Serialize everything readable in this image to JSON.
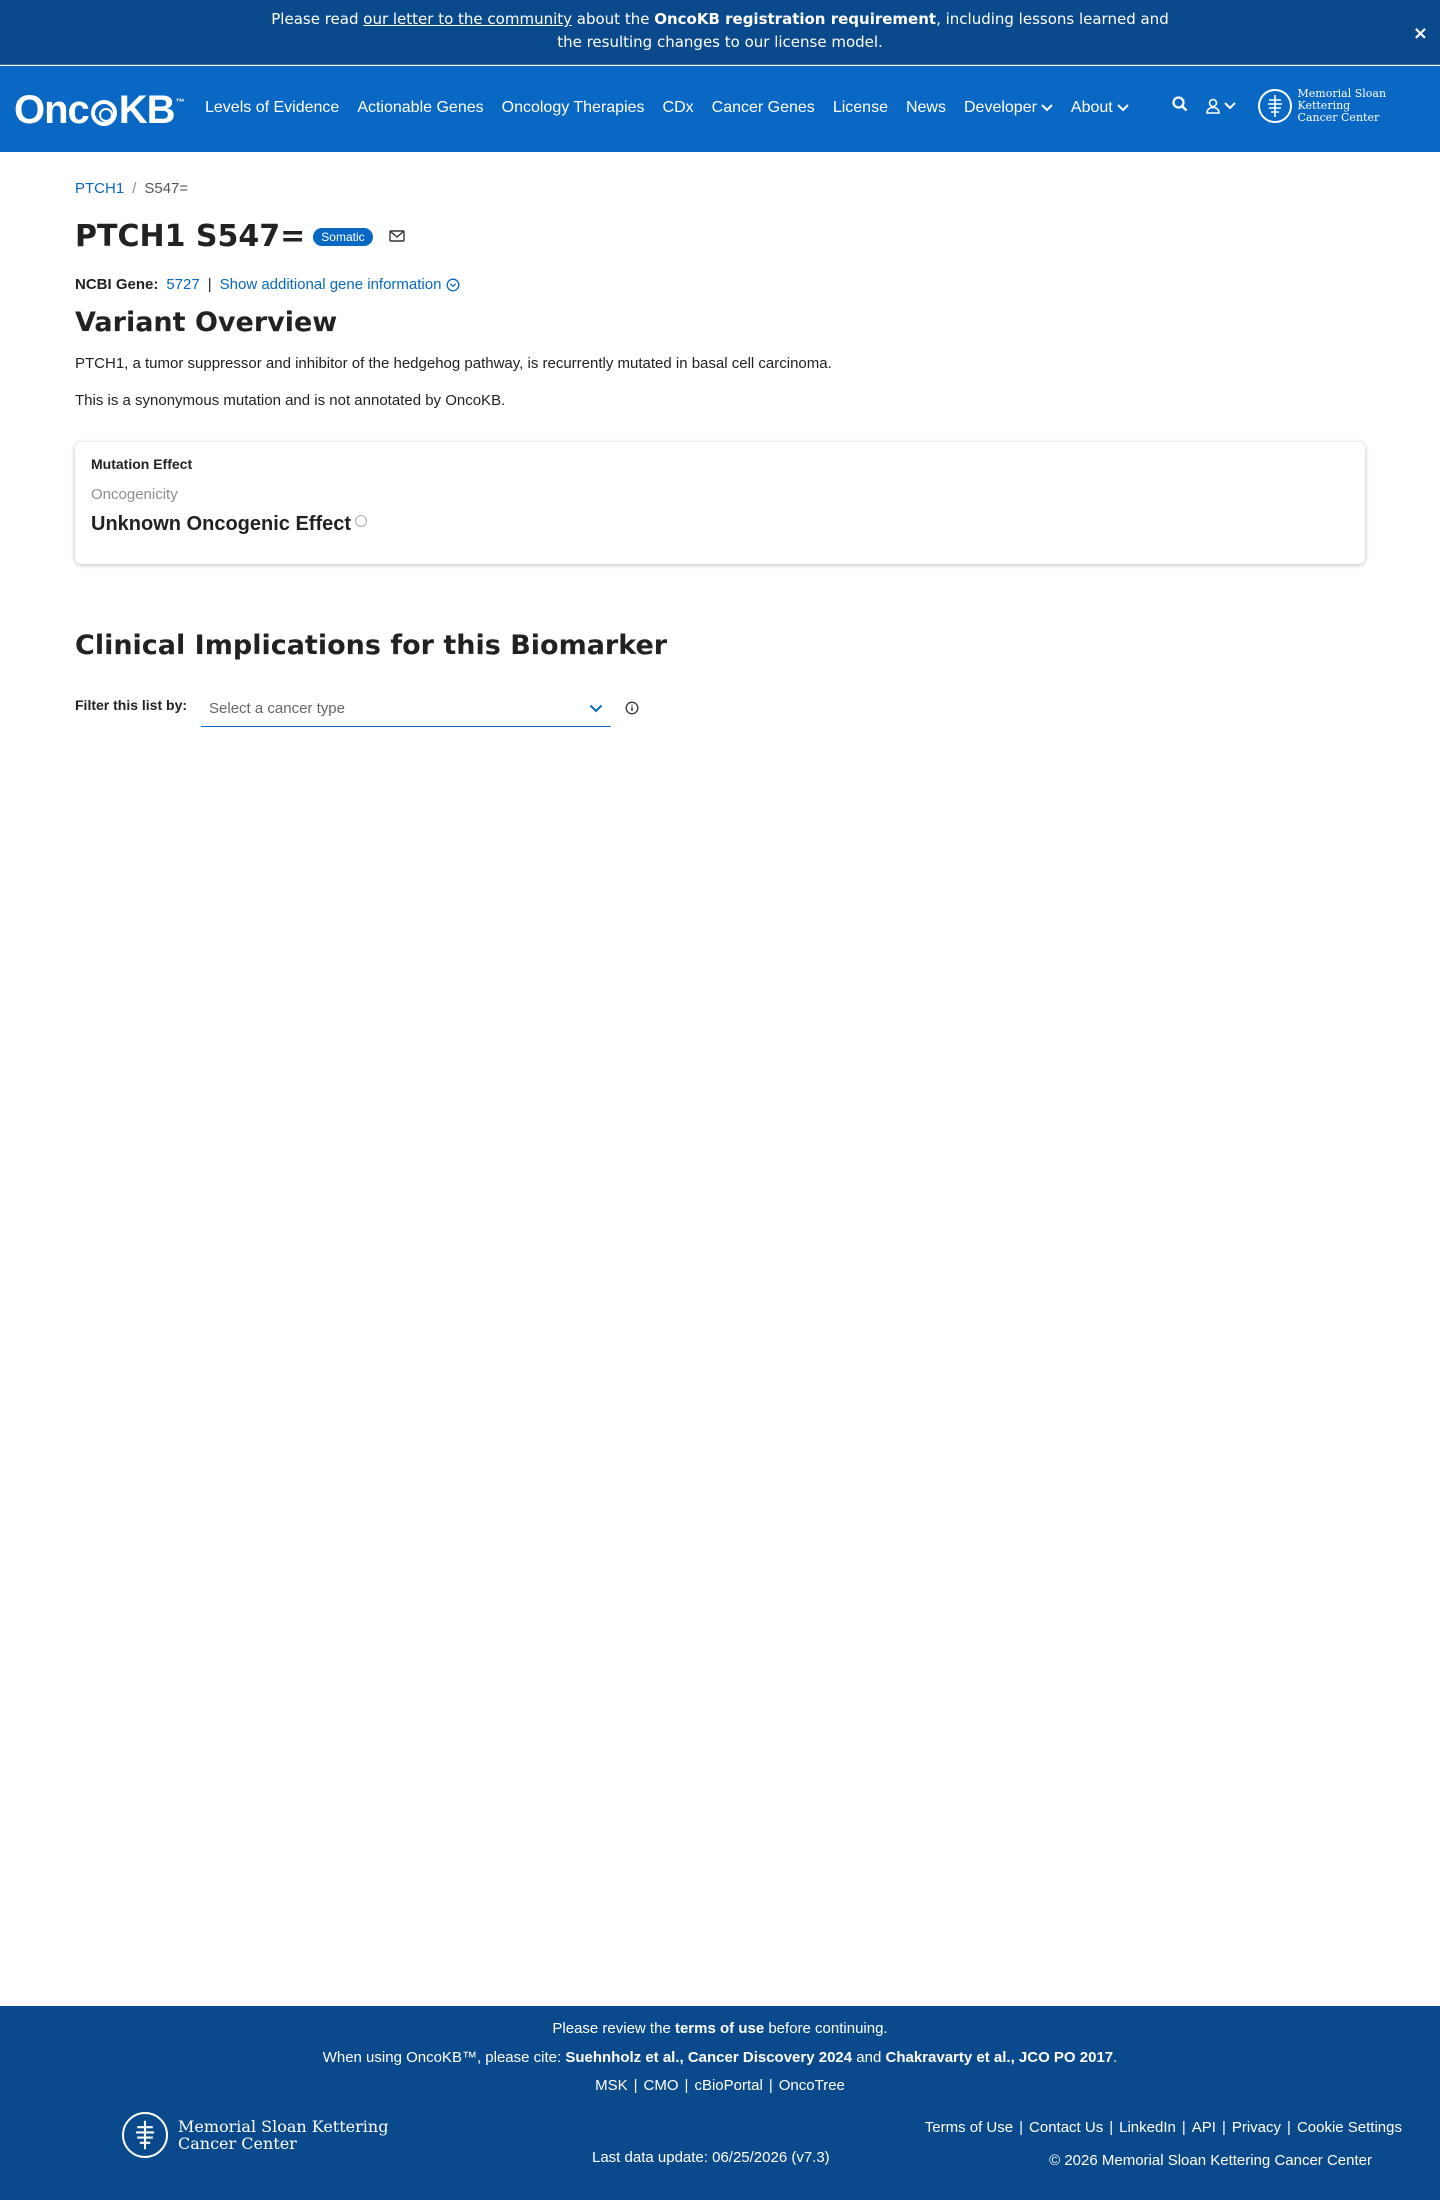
{
  "banner": {
    "prefix": "Please read ",
    "link": "our letter to the community",
    "middle": " about the ",
    "bold": "OncoKB registration requirement",
    "suffix1": ", including lessons learned and",
    "suffix2": "the resulting changes to our license model.",
    "close": "×"
  },
  "navbar": {
    "logo_left": "Onc",
    "logo_right": "KB",
    "logo_tm": "™",
    "items": [
      "Levels of Evidence",
      "Actionable Genes",
      "Oncology Therapies",
      "CDx",
      "Cancer Genes",
      "License",
      "News",
      "Developer",
      "About"
    ],
    "msk_line1": "Memorial Sloan Kettering",
    "msk_line2": "Cancer Center"
  },
  "breadcrumb": {
    "gene": "PTCH1",
    "sep": "/",
    "variant": "S547="
  },
  "page": {
    "title": "PTCH1 S547=",
    "badge": "Somatic",
    "ncbi_label": "NCBI Gene:",
    "ncbi_value": "5727",
    "pipe": "|",
    "more_info": "Show additional gene information",
    "overview_heading": "Variant Overview",
    "overview_p1": "PTCH1, a tumor suppressor and inhibitor of the hedgehog pathway, is recurrently mutated in basal cell carcinoma.",
    "overview_p2": "This is a synonymous mutation and is not annotated by OncoKB."
  },
  "card": {
    "title": "Mutation Effect",
    "subtitle": "Oncogenicity",
    "value": "Unknown Oncogenic Effect"
  },
  "clinical": {
    "heading": "Clinical Implications for this Biomarker",
    "filter_label": "Filter this list by:",
    "select_placeholder": "Select a cancer type"
  },
  "footer": {
    "r1_prefix": "Please review the ",
    "r1_bold": "terms of use",
    "r1_suffix": " before continuing.",
    "r2_prefix": "When using OncoKB™, please cite: ",
    "r2_cite1": "Suehnholz et al., Cancer Discovery 2024",
    "r2_and": " and ",
    "r2_cite2": "Chakravarty et al., JCO PO 2017",
    "r2_end": ".",
    "partners": [
      "MSK",
      "CMO",
      "cBioPortal",
      "OncoTree"
    ],
    "msk_line1": "Memorial Sloan Kettering",
    "msk_line2": "Cancer Center",
    "last_update": "Last data update: 06/25/2026 (v7.3)",
    "links": [
      "Terms of Use",
      "Contact Us",
      "LinkedIn",
      "API",
      "Privacy",
      "Cookie Settings"
    ],
    "copyright": "© 2026 Memorial Sloan Kettering Cancer Center",
    "sep": "|"
  },
  "colors": {
    "brand": "#0968c3",
    "dark": "#0a4a8c"
  }
}
